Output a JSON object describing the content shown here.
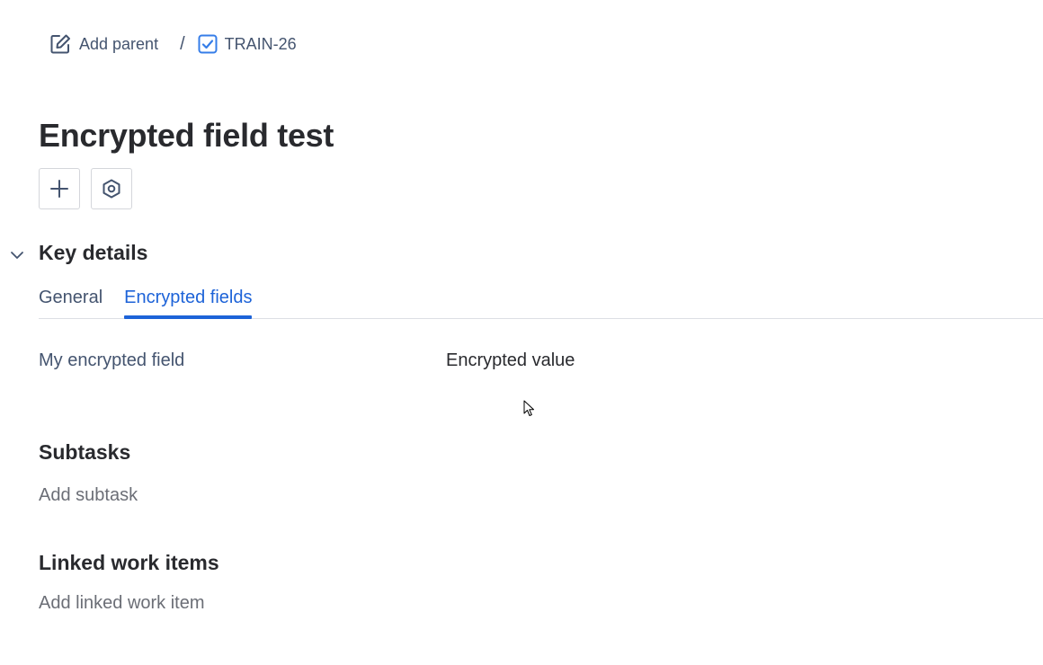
{
  "breadcrumb": {
    "add_parent_label": "Add parent",
    "separator": "/",
    "issue_key": "TRAIN-26"
  },
  "issue": {
    "title": "Encrypted field test"
  },
  "actions": {
    "add_icon": "plus-icon",
    "apps_icon": "hexagon-icon"
  },
  "key_details": {
    "heading": "Key details",
    "tabs": [
      {
        "label": "General",
        "active": false
      },
      {
        "label": "Encrypted fields",
        "active": true
      }
    ],
    "fields": [
      {
        "label": "My encrypted field",
        "value": "Encrypted value"
      }
    ]
  },
  "subtasks": {
    "heading": "Subtasks",
    "add_label": "Add subtask"
  },
  "linked_items": {
    "heading": "Linked work items",
    "add_label": "Add linked work item"
  },
  "colors": {
    "accent": "#1d63d8",
    "text": "#292a2e",
    "subtle_text": "#44546f",
    "placeholder_text": "#6b6e76"
  }
}
